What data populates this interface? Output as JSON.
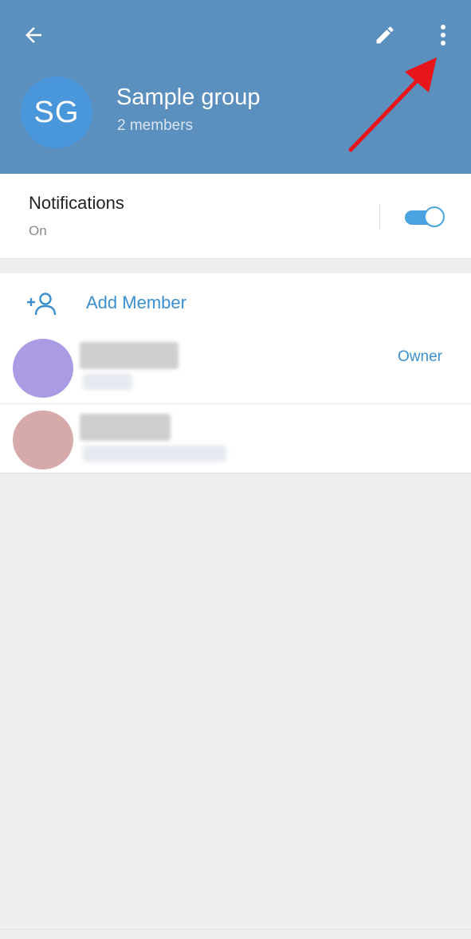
{
  "header": {
    "avatar_initials": "SG",
    "title": "Sample group",
    "subtitle": "2 members",
    "background_color": "#5b8fbe",
    "icons": [
      "back-arrow-icon",
      "pencil-icon",
      "more-vertical-icon"
    ]
  },
  "notifications": {
    "label": "Notifications",
    "value": "On",
    "toggle_on": true
  },
  "members": {
    "add_label": "Add Member",
    "rows": [
      {
        "role": "Owner",
        "avatar_color": "#ab9ae4"
      },
      {
        "role": "",
        "avatar_color": "#d5aaa9"
      }
    ]
  },
  "colors": {
    "accent": "#3a8fcf",
    "toggle": "#4aa3e0",
    "annotation_arrow": "#e8161b"
  }
}
